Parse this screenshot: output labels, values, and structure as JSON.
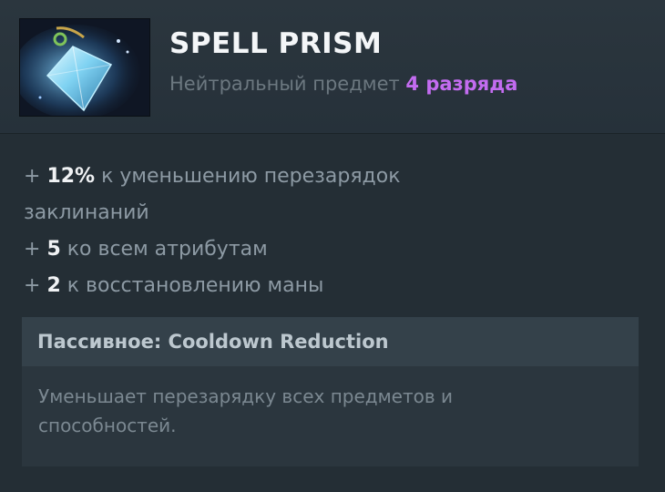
{
  "item": {
    "name": "SPELL PRISM",
    "subtitle_prefix": "Нейтральный предмет",
    "tier": "4 разряда",
    "icon": "spell-prism-crystal-icon",
    "colors": {
      "tier": "#c36cf0",
      "value": "#f0f2f4",
      "text": "#8d9aa4"
    }
  },
  "stats": [
    {
      "plus": "+",
      "value": "12%",
      "text": "к уменьшению перезарядок"
    },
    {
      "plus": "",
      "value": "",
      "text": "заклинаний"
    },
    {
      "plus": "+",
      "value": "5",
      "text": "ко всем атрибутам"
    },
    {
      "plus": "+",
      "value": "2",
      "text": "к восстановлению маны"
    }
  ],
  "ability": {
    "header": "Пассивное: Cooldown Reduction",
    "description_line1": "Уменьшает перезарядку всех предметов и",
    "description_line2": "способностей."
  }
}
